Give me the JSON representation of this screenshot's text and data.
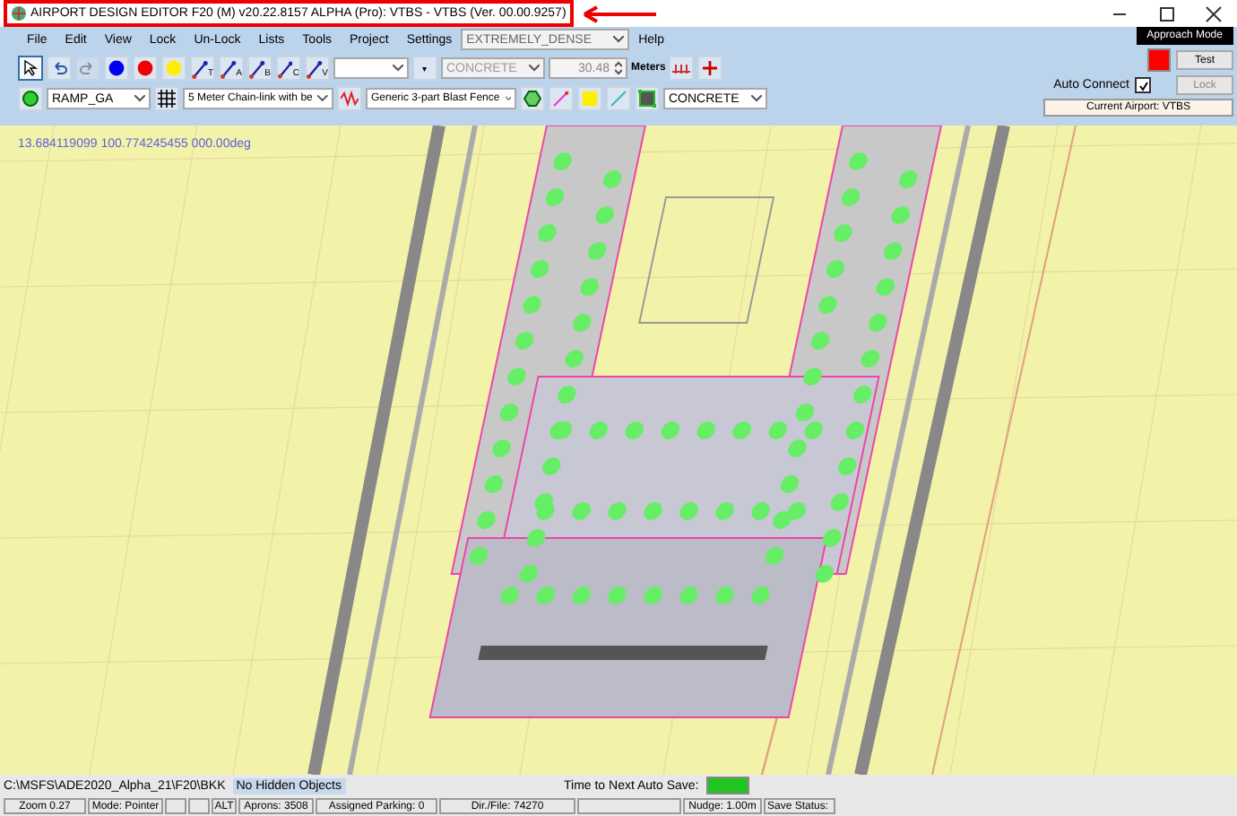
{
  "window": {
    "title": "AIRPORT DESIGN EDITOR F20 (M)  v20.22.8157 ALPHA (Pro): VTBS - VTBS (Ver. 00.00.9257)",
    "highlighted": true
  },
  "menu": [
    {
      "label": "File"
    },
    {
      "label": "Edit"
    },
    {
      "label": "View"
    },
    {
      "label": "Lock"
    },
    {
      "label": "Un-Lock"
    },
    {
      "label": "Lists"
    },
    {
      "label": "Tools"
    },
    {
      "label": "Project"
    },
    {
      "label": "Settings"
    },
    {
      "kind": "dropdown",
      "value": "EXTREMELY_DENSE"
    },
    {
      "label": "Help"
    }
  ],
  "toolbar_row_1": [
    {
      "kind": "pointer",
      "selected": true
    },
    {
      "kind": "undo",
      "disabled": false
    },
    {
      "kind": "redo",
      "disabled": true
    },
    {
      "kind": "color",
      "color": "#0000ee"
    },
    {
      "kind": "color",
      "color": "#ee0000"
    },
    {
      "kind": "color",
      "color": "#ffee00"
    },
    {
      "kind": "line",
      "label": "T"
    },
    {
      "kind": "line",
      "label": "A"
    },
    {
      "kind": "line",
      "label": "B"
    },
    {
      "kind": "line",
      "label": "C"
    },
    {
      "kind": "line",
      "label": "V"
    },
    {
      "kind": "dropdown"
    },
    {
      "kind": "small",
      "label": "▾"
    },
    {
      "kind": "dropdown",
      "value": "CONCRETE",
      "disabled": true
    },
    {
      "kind": "spinner",
      "value": "30.48",
      "disabled": true
    },
    {
      "kind": "text",
      "label": "Meters"
    },
    {
      "kind": "fence"
    },
    {
      "kind": "plus"
    }
  ],
  "toolbar_row_2": [
    {
      "kind": "circle-tool"
    },
    {
      "kind": "dropdown",
      "value": "RAMP_GA",
      "disabled": false
    },
    {
      "kind": "grid"
    },
    {
      "kind": "dropdown",
      "value": "5 Meter Chain-link with be",
      "disabled": false
    },
    {
      "kind": "zigzag"
    },
    {
      "kind": "dropdown",
      "value": "Generic 3-part Blast Fence",
      "disabled": false
    },
    {
      "kind": "hexagon"
    },
    {
      "kind": "pen"
    },
    {
      "kind": "color",
      "color": "#ffee00"
    },
    {
      "kind": "diagonal"
    },
    {
      "kind": "square-tool"
    },
    {
      "kind": "dropdown",
      "value": "CONCRETE",
      "disabled": false
    }
  ],
  "right_panel": {
    "mode_label": "Approach Mode",
    "test_button": "Test",
    "auto_connect": {
      "label": "Auto Connect",
      "checked": true
    },
    "lock_button": {
      "label": "Lock",
      "disabled": true
    },
    "current_airport": "Current Airport: VTBS"
  },
  "map": {
    "coordinates": "13.684119099  100.774245455 000.00deg"
  },
  "info_bar": {
    "path": "C:\\MSFS\\ADE2020_Alpha_21\\F20\\BKK",
    "hidden_objects": "No Hidden Objects",
    "autosave": {
      "label": "Time to Next Auto Save:",
      "level": 1
    }
  },
  "status_bar": [
    {
      "text": "Zoom 0.27"
    },
    {
      "text": "Mode: Pointer"
    },
    {
      "kind": "blank"
    },
    {
      "kind": "blank"
    },
    {
      "text": "ALT"
    },
    {
      "text": "Aprons: 3508"
    },
    {
      "text": "Assigned Parking: 0"
    },
    {
      "text": "Dir./File: 74270"
    },
    {
      "kind": "blank"
    },
    {
      "text": "Nudge: 1.00m"
    },
    {
      "text": "Save Status:",
      "kind": "save-status"
    }
  ]
}
